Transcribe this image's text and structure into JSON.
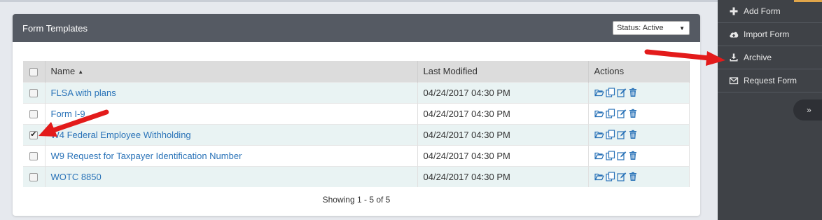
{
  "panel": {
    "title": "Form Templates",
    "status_filter": "Status: Active"
  },
  "table": {
    "columns": [
      "Name",
      "Last Modified",
      "Actions"
    ],
    "rows": [
      {
        "name": "FLSA with plans",
        "modified": "04/24/2017 04:30 PM",
        "checked": false
      },
      {
        "name": "Form I-9",
        "modified": "04/24/2017 04:30 PM",
        "checked": false
      },
      {
        "name": "W4 Federal Employee Withholding",
        "modified": "04/24/2017 04:30 PM",
        "checked": true
      },
      {
        "name": "W9 Request for Taxpayer Identification Number",
        "modified": "04/24/2017 04:30 PM",
        "checked": false
      },
      {
        "name": "WOTC 8850",
        "modified": "04/24/2017 04:30 PM",
        "checked": false
      }
    ],
    "row_actions": [
      "folder-open-icon",
      "copy-icon",
      "edit-icon",
      "trash-icon"
    ]
  },
  "footer": {
    "showing": "Showing 1 - 5 of 5"
  },
  "sidebar": {
    "items": [
      {
        "label": "Add Form",
        "icon": "plus-icon"
      },
      {
        "label": "Import Form",
        "icon": "cloud-upload-icon"
      },
      {
        "label": "Archive",
        "icon": "download-icon"
      },
      {
        "label": "Request Form",
        "icon": "envelope-icon"
      }
    ],
    "collapse_label": "»"
  },
  "colors": {
    "header_bg": "#555a63",
    "sidebar_bg": "#3f4247",
    "link": "#2a73b8",
    "row_alt": "#e9f3f3",
    "annotation_arrow": "#e31b1b"
  }
}
